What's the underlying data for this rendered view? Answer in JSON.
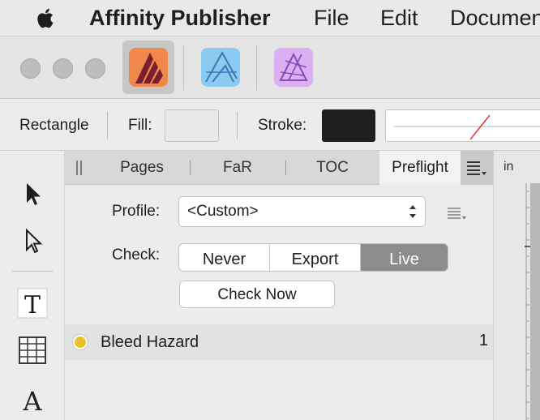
{
  "menubar": {
    "app_name": "Affinity Publisher",
    "menus": [
      "File",
      "Edit",
      "Documen"
    ]
  },
  "toolbar": {
    "personas": [
      {
        "name": "Publisher Persona",
        "color": "#f0884c",
        "active": true
      },
      {
        "name": "Designer Persona",
        "color": "#7fc1ea",
        "active": false
      },
      {
        "name": "Photo Persona",
        "color": "#d7a9f0",
        "active": false
      }
    ]
  },
  "context": {
    "shape_label": "Rectangle",
    "fill_label": "Fill:",
    "stroke_label": "Stroke:",
    "fill_color": "#e9e9e9",
    "stroke_color": "#1e1e1e"
  },
  "tools": [
    "move-tool",
    "node-tool",
    "frame-text-tool",
    "table-tool",
    "artistic-text-tool"
  ],
  "panel": {
    "tabs": [
      "Pages",
      "FaR",
      "TOC",
      "Preflight"
    ],
    "active_tab": "Preflight",
    "profile_label": "Profile:",
    "profile_value": "<Custom>",
    "check_label": "Check:",
    "check_options": [
      "Never",
      "Export",
      "Live"
    ],
    "check_selected": "Live",
    "check_now_label": "Check Now",
    "results": [
      {
        "title": "Bleed Hazard",
        "count": "1",
        "status_color": "#e7c22c"
      }
    ]
  },
  "ruler": {
    "unit": "in"
  }
}
